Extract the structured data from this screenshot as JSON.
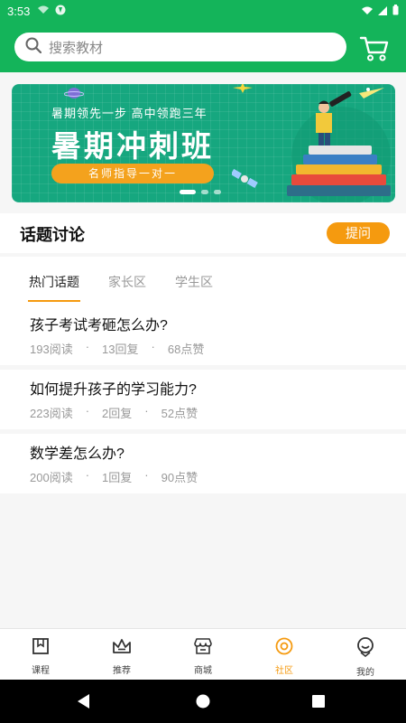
{
  "status_bar": {
    "time": "3:53"
  },
  "search": {
    "placeholder": "搜索教材"
  },
  "banner": {
    "subtitle": "暑期领先一步 高中领跑三年",
    "title": "暑期冲刺班",
    "pill": "名师指导一对一",
    "dots": 3,
    "active_dot": 0
  },
  "section": {
    "title": "话题讨论",
    "ask_label": "提问"
  },
  "tabs": [
    {
      "label": "热门话题",
      "active": true
    },
    {
      "label": "家长区",
      "active": false
    },
    {
      "label": "学生区",
      "active": false
    }
  ],
  "topics": [
    {
      "question": "孩子考试考砸怎么办?",
      "reads": "193阅读",
      "replies": "13回复",
      "likes": "68点赞"
    },
    {
      "question": "如何提升孩子的学习能力?",
      "reads": "223阅读",
      "replies": "2回复",
      "likes": "52点赞"
    },
    {
      "question": "数学差怎么办?",
      "reads": "200阅读",
      "replies": "1回复",
      "likes": "90点赞"
    }
  ],
  "meta_separator": "·",
  "bottom_nav": [
    {
      "label": "课程",
      "icon": "book-icon",
      "active": false
    },
    {
      "label": "推荐",
      "icon": "crown-icon",
      "active": false
    },
    {
      "label": "商城",
      "icon": "shop-icon",
      "active": false
    },
    {
      "label": "社区",
      "icon": "community-icon",
      "active": true
    },
    {
      "label": "我的",
      "icon": "profile-icon",
      "active": false
    }
  ],
  "colors": {
    "brand_green": "#14b45a",
    "accent_orange": "#f59a0f",
    "banner_teal": "#16a77f"
  }
}
